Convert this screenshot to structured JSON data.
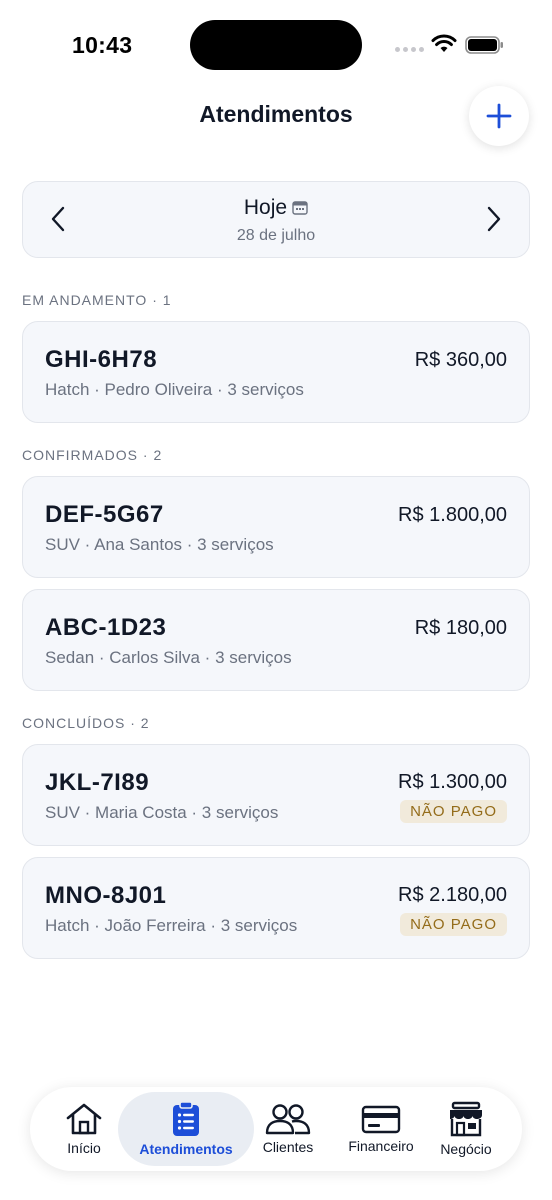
{
  "status_bar": {
    "time": "10:43"
  },
  "header": {
    "title": "Atendimentos",
    "add_icon": "plus-icon"
  },
  "date_selector": {
    "title": "Hoje",
    "subtitle": "28 de julho",
    "prev_icon": "chevron-left-icon",
    "next_icon": "chevron-right-icon",
    "calendar_icon": "calendar-icon"
  },
  "sections": [
    {
      "label": "EM ANDAMENTO · 1",
      "items": [
        {
          "plate": "GHI-6H78",
          "details": "Hatch · Pedro Oliveira · 3 serviços",
          "price": "R$ 360,00"
        }
      ]
    },
    {
      "label": "CONFIRMADOS · 2",
      "items": [
        {
          "plate": "DEF-5G67",
          "details": "SUV · Ana Santos · 3 serviços",
          "price": "R$ 1.800,00"
        },
        {
          "plate": "ABC-1D23",
          "details": "Sedan · Carlos Silva · 3 serviços",
          "price": "R$ 180,00"
        }
      ]
    },
    {
      "label": "CONCLUÍDOS · 2",
      "items": [
        {
          "plate": "JKL-7I89",
          "details": "SUV · Maria Costa · 3 serviços",
          "price": "R$ 1.300,00",
          "badge": "NÃO PAGO"
        },
        {
          "plate": "MNO-8J01",
          "details": "Hatch · João Ferreira · 3 serviços",
          "price": "R$ 2.180,00",
          "badge": "NÃO PAGO"
        }
      ]
    }
  ],
  "tab_bar": {
    "tabs": [
      {
        "label": "Início",
        "icon": "home-icon"
      },
      {
        "label": "Atendimentos",
        "icon": "clipboard-list-icon",
        "active": true
      },
      {
        "label": "Clientes",
        "icon": "users-icon"
      },
      {
        "label": "Financeiro",
        "icon": "credit-card-icon"
      },
      {
        "label": "Negócio",
        "icon": "store-icon"
      }
    ]
  },
  "colors": {
    "accent": "#1d4ed8",
    "badge_bg": "#f1eadb",
    "badge_text": "#946c1a",
    "card_bg": "#f5f7fb"
  }
}
